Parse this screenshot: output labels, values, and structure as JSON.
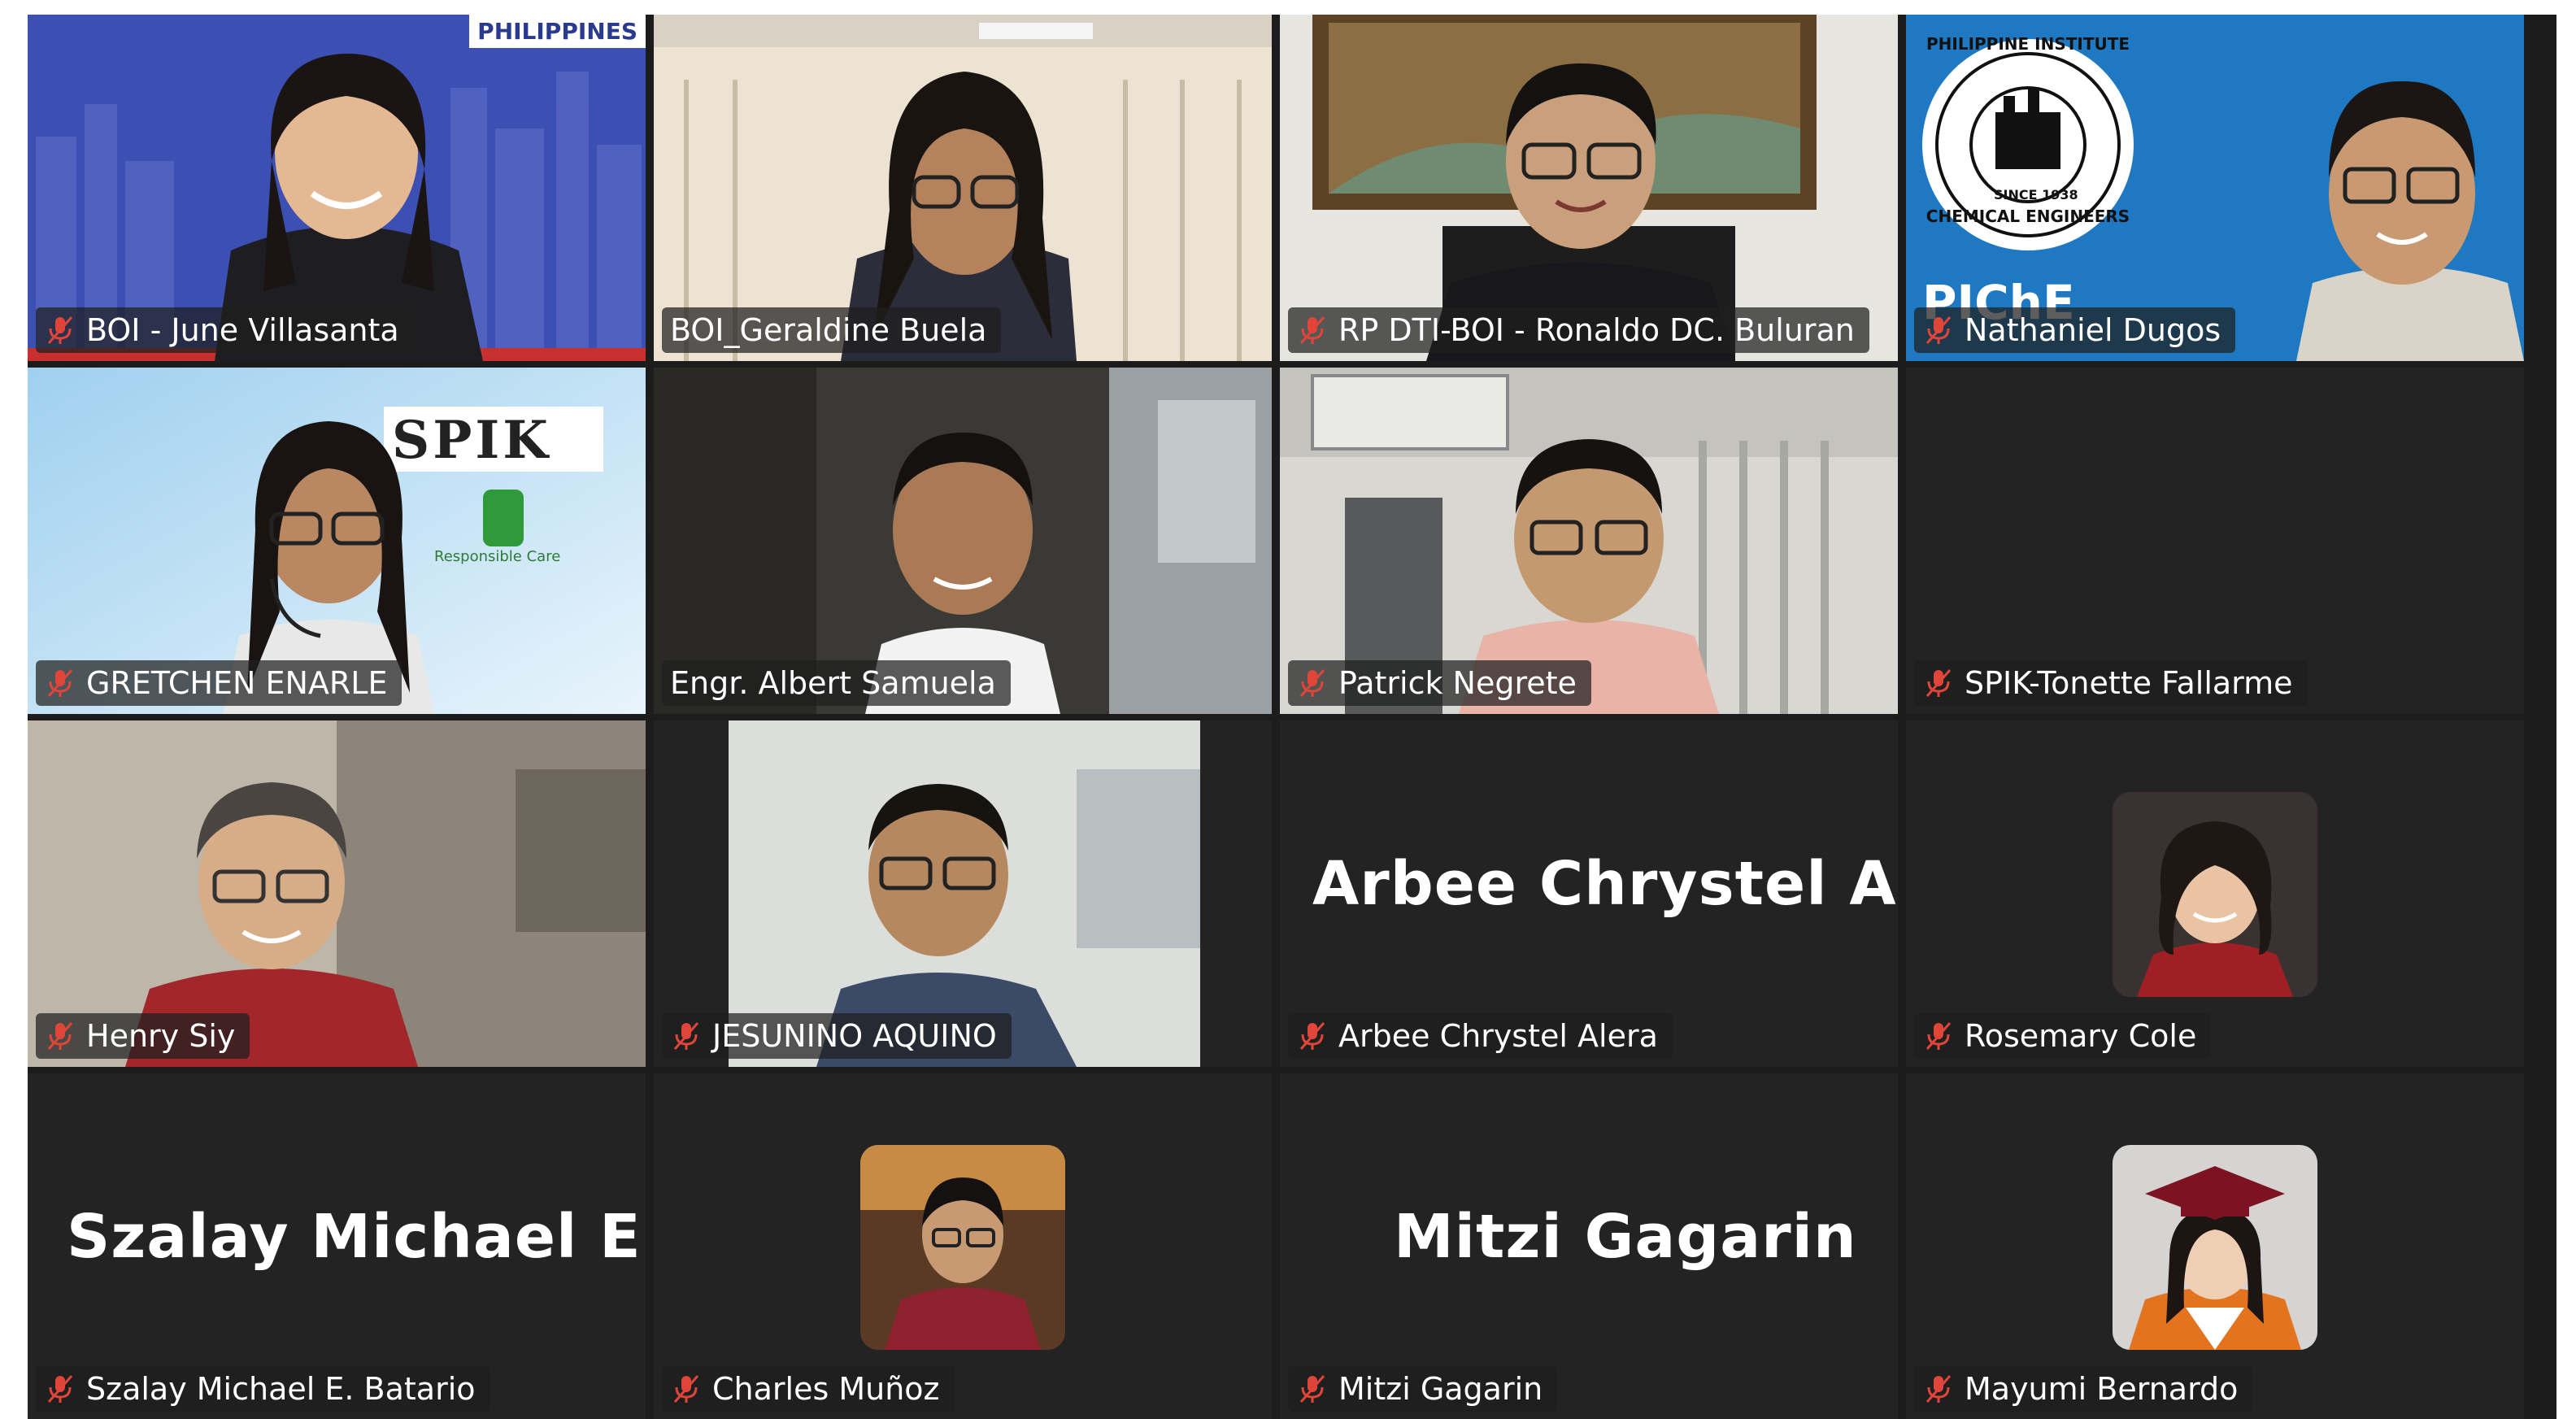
{
  "meeting": {
    "participants": [
      {
        "name": "BOI - June Villasanta",
        "muted": true
      },
      {
        "name": "BOI_Geraldine Buela",
        "muted": false,
        "active_speaker": true
      },
      {
        "name": "RP DTI-BOI - Ronaldo DC. Buluran",
        "muted": true
      },
      {
        "name": "Nathaniel Dugos",
        "muted": true
      },
      {
        "name": "GRETCHEN ENARLE",
        "muted": true
      },
      {
        "name": "Engr. Albert Samuela",
        "muted": false
      },
      {
        "name": "Patrick Negrete",
        "muted": true
      },
      {
        "name": "SPIK-Tonette Fallarme",
        "muted": true
      },
      {
        "name": "Henry Siy",
        "muted": true
      },
      {
        "name": "JESUNINO AQUINO",
        "muted": true
      },
      {
        "name": "Arbee Chrystel Alera",
        "muted": true,
        "display": "Arbee Chrystel A..."
      },
      {
        "name": "Rosemary Cole",
        "muted": true
      },
      {
        "name": "Szalay Michael E. Batario",
        "muted": true,
        "display": "Szalay Michael E..."
      },
      {
        "name": "Charles Muñoz",
        "muted": true
      },
      {
        "name": "Mitzi Gagarin",
        "muted": true,
        "display": "Mitzi Gagarin"
      },
      {
        "name": "Mayumi Bernardo",
        "muted": true
      }
    ]
  },
  "backgrounds": {
    "philippines_banner": "PHILIPPINES",
    "spik_logo": "SPIK",
    "responsible_care": "Responsible Care",
    "piche_seal_top": "PHILIPPINE INSTITUTE",
    "piche_seal_bottom": "CHEMICAL ENGINEERS",
    "piche_since": "SINCE 1938",
    "piche_text": "PIChE"
  },
  "colors": {
    "active_border": "#23d160",
    "muted_icon": "#e0453a",
    "tile_bg": "#232323",
    "stage_bg": "#1c1c1c"
  }
}
